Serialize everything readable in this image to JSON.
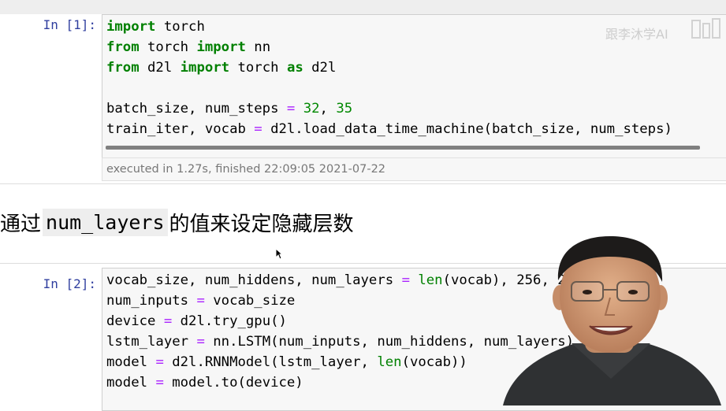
{
  "cells": [
    {
      "prompt": "In [1]:",
      "lines": [
        [
          {
            "t": "import",
            "c": "kw"
          },
          {
            "t": " torch",
            "c": ""
          }
        ],
        [
          {
            "t": "from",
            "c": "kw"
          },
          {
            "t": " torch ",
            "c": ""
          },
          {
            "t": "import",
            "c": "kw"
          },
          {
            "t": " nn",
            "c": ""
          }
        ],
        [
          {
            "t": "from",
            "c": "kw"
          },
          {
            "t": " d2l ",
            "c": ""
          },
          {
            "t": "import",
            "c": "kw"
          },
          {
            "t": " torch ",
            "c": ""
          },
          {
            "t": "as",
            "c": "kw"
          },
          {
            "t": " d2l",
            "c": ""
          }
        ],
        [],
        [
          {
            "t": "batch_size, num_steps ",
            "c": ""
          },
          {
            "t": "=",
            "c": "op"
          },
          {
            "t": " ",
            "c": ""
          },
          {
            "t": "32",
            "c": "num"
          },
          {
            "t": ", ",
            "c": ""
          },
          {
            "t": "35",
            "c": "num"
          }
        ],
        [
          {
            "t": "train_iter, vocab ",
            "c": ""
          },
          {
            "t": "=",
            "c": "op"
          },
          {
            "t": " d2l.load_data_time_machine(batch_size, num_steps)",
            "c": ""
          }
        ]
      ],
      "exec_info": "executed in 1.27s, finished 22:09:05 2021-07-22"
    },
    {
      "prompt": "In [2]:",
      "lines": [
        [
          {
            "t": "vocab_size, num_hiddens, num_layers ",
            "c": ""
          },
          {
            "t": "=",
            "c": "op"
          },
          {
            "t": " ",
            "c": ""
          },
          {
            "t": "len",
            "c": "bi"
          },
          {
            "t": "(vocab), 256, 2",
            "c": ""
          }
        ],
        [
          {
            "t": "num_inputs ",
            "c": ""
          },
          {
            "t": "=",
            "c": "op"
          },
          {
            "t": " vocab_size",
            "c": ""
          }
        ],
        [
          {
            "t": "device ",
            "c": ""
          },
          {
            "t": "=",
            "c": "op"
          },
          {
            "t": " d2l.try_gpu()",
            "c": ""
          }
        ],
        [
          {
            "t": "lstm_layer ",
            "c": ""
          },
          {
            "t": "=",
            "c": "op"
          },
          {
            "t": " nn.LSTM(num_inputs, num_hiddens, num_layers)",
            "c": ""
          }
        ],
        [
          {
            "t": "model ",
            "c": ""
          },
          {
            "t": "=",
            "c": "op"
          },
          {
            "t": " d2l.RNNModel(lstm_layer, ",
            "c": ""
          },
          {
            "t": "len",
            "c": "bi"
          },
          {
            "t": "(vocab))",
            "c": ""
          }
        ],
        [
          {
            "t": "model ",
            "c": ""
          },
          {
            "t": "=",
            "c": "op"
          },
          {
            "t": " model.to(device)",
            "c": ""
          }
        ]
      ]
    }
  ],
  "markdown": {
    "prefix": "通过",
    "code": "num_layers",
    "suffix": "的值来设定隐藏层数"
  },
  "watermark": "跟李沐学AI"
}
